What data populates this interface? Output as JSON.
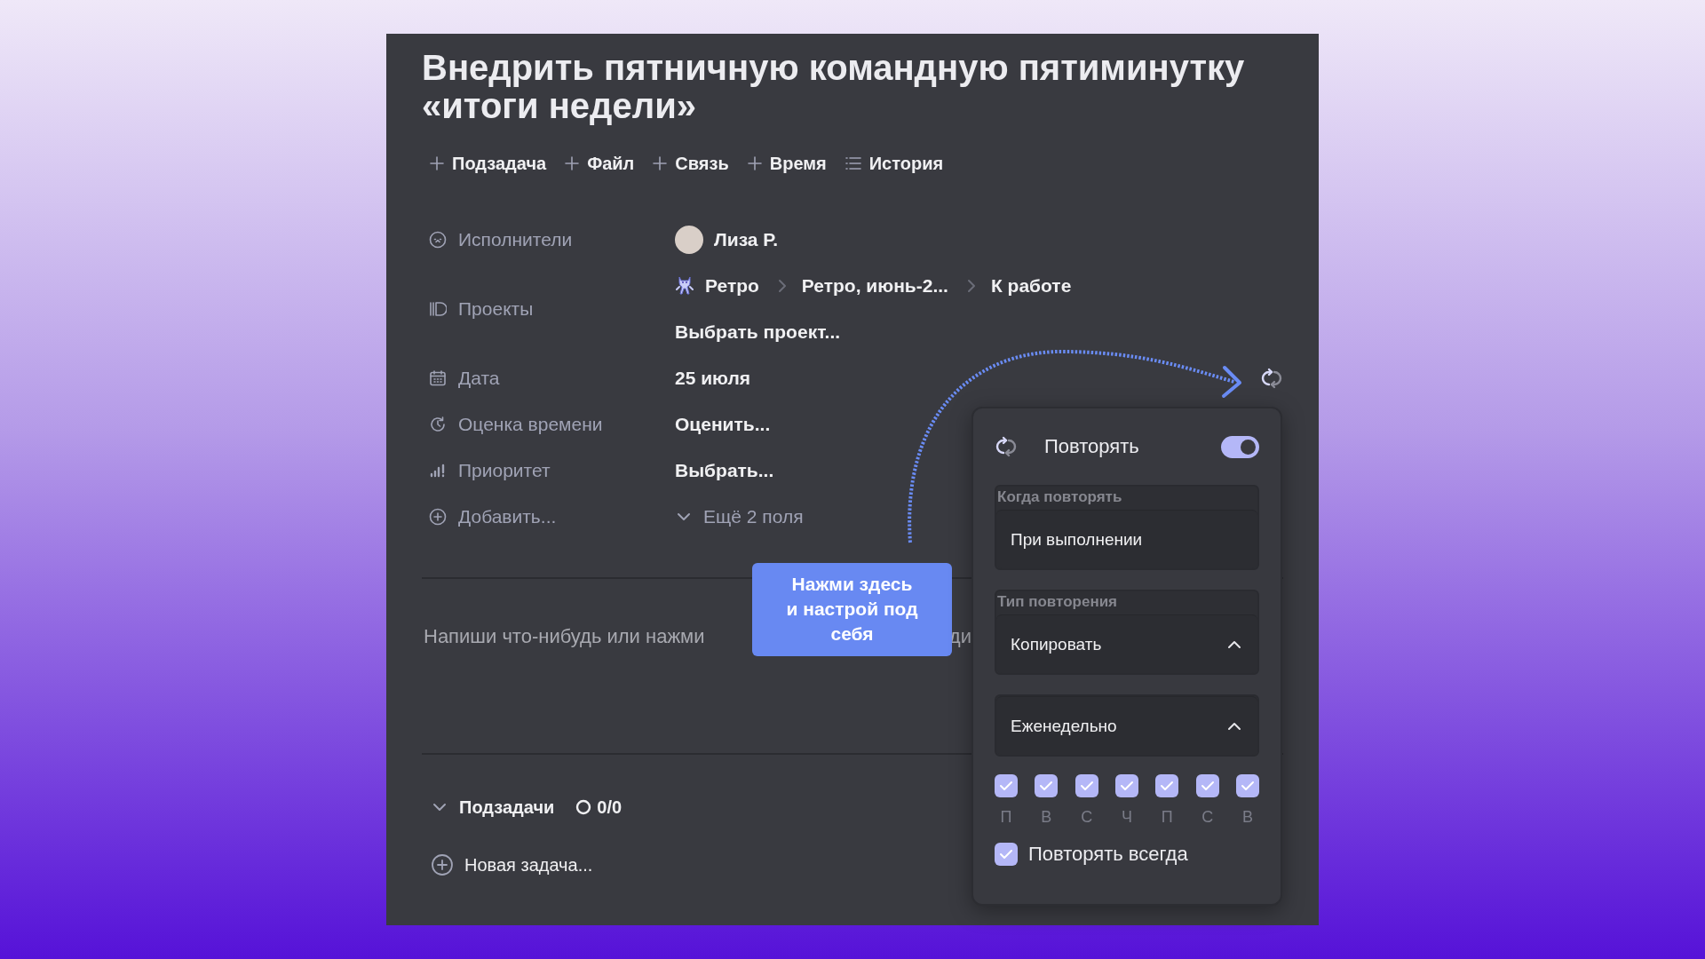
{
  "task": {
    "title": "Внедрить пятничную командную пятиминутку «итоги недели»"
  },
  "actions": [
    {
      "kind": "add",
      "label": "Подзадача"
    },
    {
      "kind": "add",
      "label": "Файл"
    },
    {
      "kind": "add",
      "label": "Связь"
    },
    {
      "kind": "add",
      "label": "Время"
    },
    {
      "kind": "list",
      "label": "История"
    }
  ],
  "fields": [
    {
      "kind": "assignees",
      "label": "Исполнители",
      "value": "Лиза Р."
    },
    {
      "kind": "projects",
      "label": "Проекты",
      "path": [
        "Ретро",
        "Ретро, июнь-2...",
        "К работе"
      ],
      "value": "Выбрать проект..."
    },
    {
      "kind": "date",
      "label": "Дата",
      "value": "25 июля",
      "repeat_set": true
    },
    {
      "kind": "estimate",
      "label": "Оценка времени",
      "value": "Оценить..."
    },
    {
      "kind": "priority",
      "label": "Приоритет",
      "value": "Выбрать..."
    },
    {
      "kind": "add",
      "label": "Добавить...",
      "value": "Ещё 2 поля"
    }
  ],
  "editor": {
    "placeholder": "Напиши что-нибудь или нажми",
    "placeholder_tail": "ди"
  },
  "subtasks": {
    "title": "Подзадачи",
    "expanded": true,
    "count": "0/0",
    "new_task": "Новая задача..."
  },
  "tooltip": {
    "text": "Нажми здесь\nи настрой под\nсебя"
  },
  "repeat_popup": {
    "title": "Повторять",
    "on": true,
    "when": {
      "label": "Когда повторять",
      "value": "При выполнении"
    },
    "type": {
      "label": "Тип повторения",
      "value": "Копировать",
      "expanded": true
    },
    "frequency": {
      "value": "Еженедельно",
      "expanded": true
    },
    "days": [
      {
        "label": "П",
        "checked": true
      },
      {
        "label": "В",
        "checked": true
      },
      {
        "label": "С",
        "checked": true
      },
      {
        "label": "Ч",
        "checked": true
      },
      {
        "label": "П",
        "checked": true
      },
      {
        "label": "С",
        "checked": true
      },
      {
        "label": "В",
        "checked": true
      }
    ],
    "forever": {
      "label": "Повторять всегда",
      "checked": true
    }
  }
}
